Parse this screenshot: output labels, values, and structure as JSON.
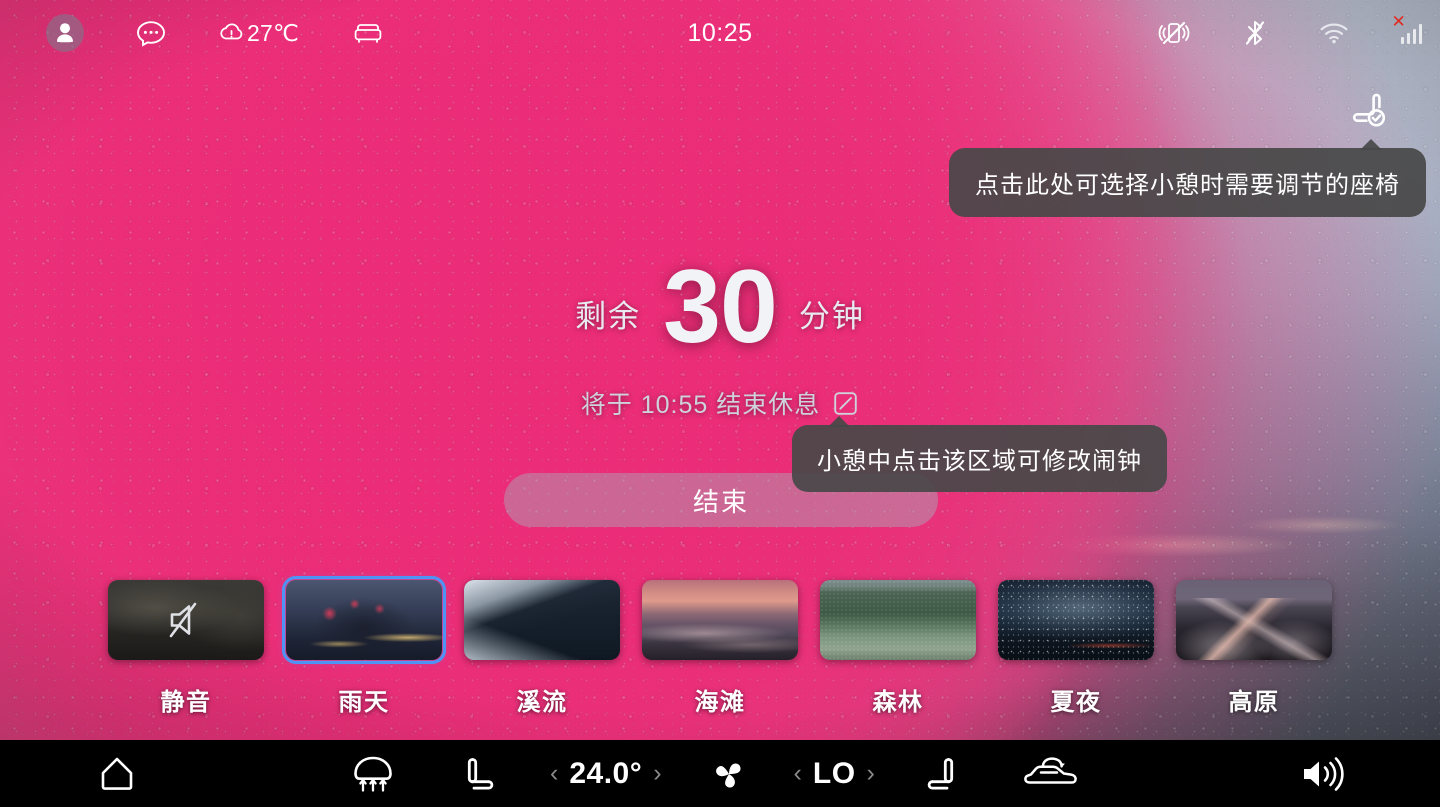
{
  "statusbar": {
    "avatar_icon": "user-avatar-icon",
    "chat_icon": "chat-bubble-icon",
    "weather_icon": "cloud-rain-icon",
    "weather_temp": "27℃",
    "sofa_icon": "armchair-icon",
    "clock": "10:25",
    "vibrate_icon": "vibrate-off-icon",
    "bluetooth_icon": "bluetooth-off-icon",
    "wifi_icon": "wifi-icon",
    "signal_icon": "signal-no-sim-icon"
  },
  "seat_shortcut": {
    "icon": "seat-check-icon",
    "tooltip": "点击此处可选择小憩时需要调节的座椅"
  },
  "nap": {
    "prefix": "剩余",
    "minutes": "30",
    "suffix": "分钟",
    "end_text": "将于 10:55 结束休息",
    "edit_icon": "edit-square-icon",
    "end_button_label": "结束",
    "alarm_tooltip": "小憩中点击该区域可修改闹钟"
  },
  "scenes": {
    "selected_index": 1,
    "selected_color": "#4d94f5",
    "items": [
      {
        "label": "静音",
        "art": "art-mute",
        "icon": "volume-mute-icon"
      },
      {
        "label": "雨天",
        "art": "art-rain",
        "icon": ""
      },
      {
        "label": "溪流",
        "art": "art-stream",
        "icon": ""
      },
      {
        "label": "海滩",
        "art": "art-beach",
        "icon": ""
      },
      {
        "label": "森林",
        "art": "art-forest",
        "icon": ""
      },
      {
        "label": "夏夜",
        "art": "art-night",
        "icon": ""
      },
      {
        "label": "高原",
        "art": "art-plateau",
        "icon": ""
      }
    ]
  },
  "bottombar": {
    "home_icon": "home-icon",
    "defrost_icon": "defrost-front-icon",
    "seat_left_icon": "seat-heat-left-icon",
    "temp_prev": "‹",
    "temp_value": "24.0°",
    "temp_next": "›",
    "fan_icon": "fan-icon",
    "fan_prev": "‹",
    "fan_value": "LO",
    "fan_next": "›",
    "seat_right_icon": "seat-heat-right-icon",
    "recirc_icon": "air-recirculation-icon",
    "volume_icon": "volume-icon"
  }
}
